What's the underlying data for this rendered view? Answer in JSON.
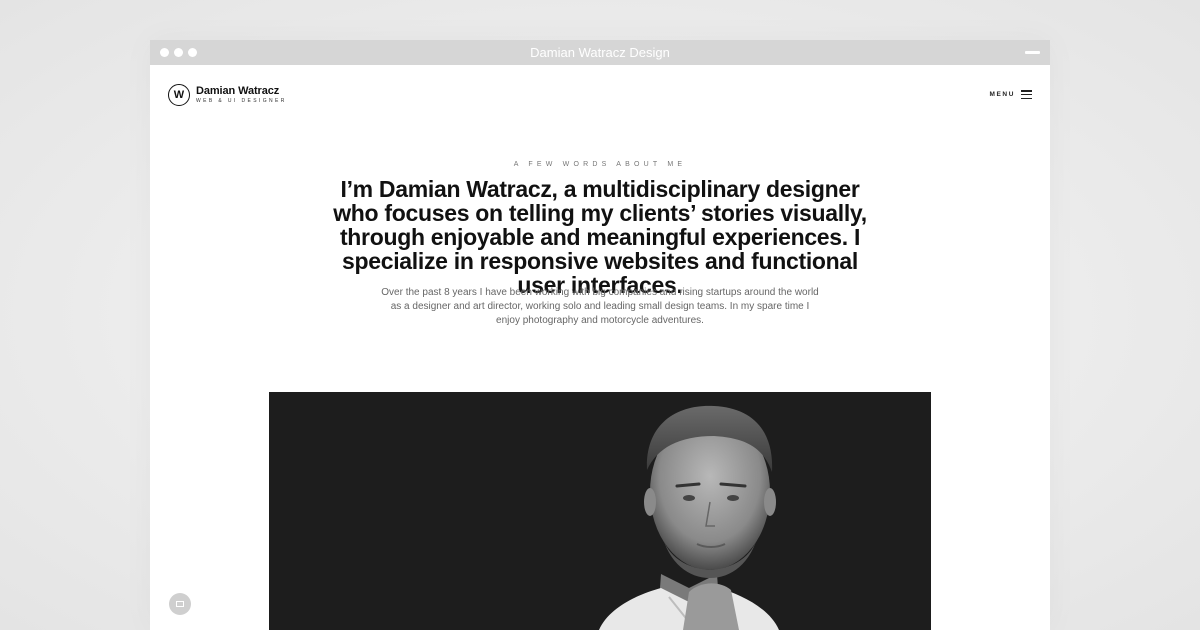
{
  "window": {
    "title": "Damian Watracz Design"
  },
  "header": {
    "logo_letter": "W",
    "logo_name": "Damian Watracz",
    "logo_tagline": "WEB & UI DESIGNER",
    "menu_label": "MENU"
  },
  "about": {
    "eyebrow": "A FEW WORDS ABOUT ME",
    "headline": "I’m Damian Watracz, a multidisciplinary designer who focuses on telling my clients’ stories visually, through enjoyable and meaningful experiences. I specialize in responsive websites and functional user interfaces.",
    "intro": "Over the past 8 years I have been working with big companies and rising startups around the world as a designer and art director, working solo and leading small design teams. In my spare time I enjoy photography and motorcycle adventures."
  },
  "icons": {
    "logo": "circle-w-logo-icon",
    "menu": "hamburger-icon",
    "contact": "mail-icon"
  },
  "colors": {
    "titlebar": "#d6d6d6",
    "hero_background": "#1d1d1d",
    "headline": "#111111",
    "body_text": "#666666"
  }
}
